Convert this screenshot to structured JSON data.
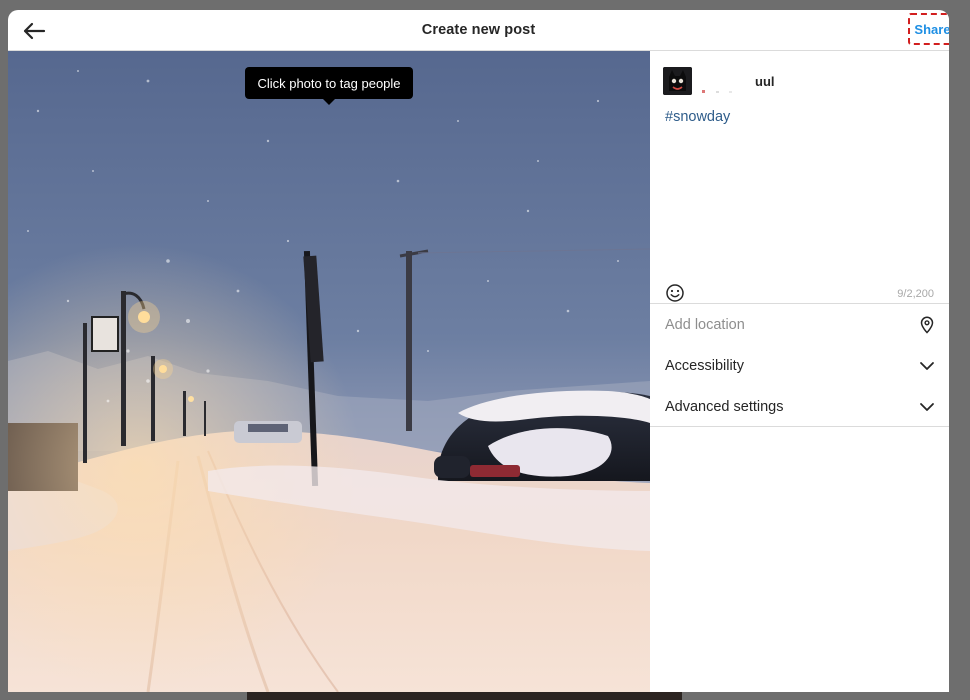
{
  "header": {
    "title": "Create new post",
    "share_label": "Share"
  },
  "photo": {
    "tooltip": "Click photo to tag people"
  },
  "composer": {
    "username": "uul",
    "caption": "#snowday",
    "char_count": "9/2,200"
  },
  "options": {
    "location_placeholder": "Add location",
    "accessibility_label": "Accessibility",
    "advanced_label": "Advanced settings"
  },
  "icons": {
    "back": "arrow-left-icon",
    "emoji": "smiley-icon",
    "location": "location-pin-icon",
    "chevron": "chevron-down-icon"
  },
  "colors": {
    "accent": "#1e8fe4",
    "highlight_border": "#d21f1f",
    "hashtag": "#2e5c8a"
  }
}
